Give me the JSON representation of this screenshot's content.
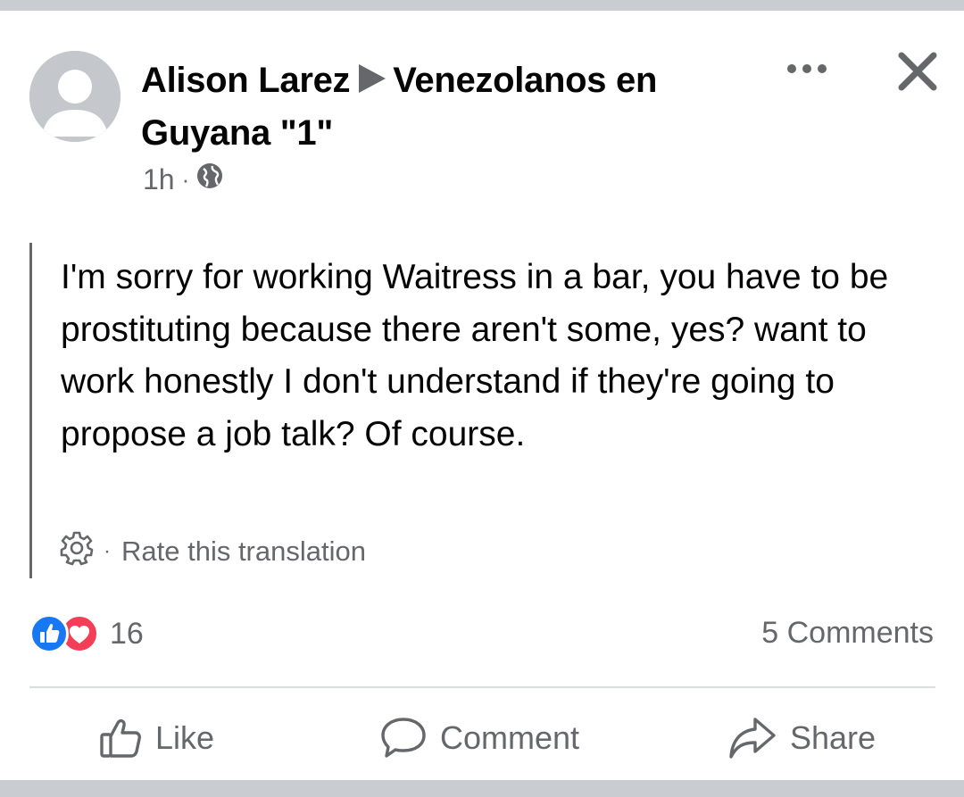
{
  "post": {
    "author": "Alison Larez",
    "group": "Venezolanos en Guyana \"1\"",
    "time": "1h",
    "separator": "·",
    "privacy_icon": "globe-icon",
    "body": "I'm sorry for working Waitress in a bar, you have to be prostituting because there aren't some, yes? want to work honestly I don't understand if they're going to propose a job talk? Of course.",
    "translation_action": "Rate this translation"
  },
  "stats": {
    "reaction_icons": [
      "like-reaction-icon",
      "love-reaction-icon"
    ],
    "reaction_count": "16",
    "comments": "5 Comments"
  },
  "actions": {
    "like": "Like",
    "comment": "Comment",
    "share": "Share"
  },
  "colors": {
    "like_blue": "#1877f2",
    "love_red": "#f33e58",
    "secondary_text": "#65676b",
    "page_background": "#c9ccd1"
  }
}
